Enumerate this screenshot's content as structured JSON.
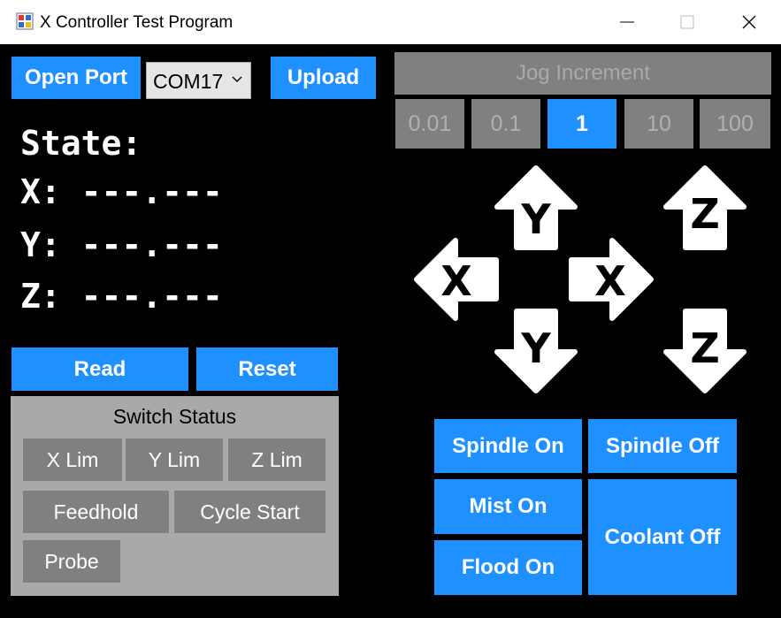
{
  "window": {
    "title": "X Controller Test Program"
  },
  "toolbar": {
    "open_port_label": "Open Port",
    "port_selected": "COM17",
    "upload_label": "Upload"
  },
  "state": {
    "state_label": "State:",
    "x_line": "X: ---.---",
    "y_line": "Y: ---.---",
    "z_line": "Z: ---.---"
  },
  "actions": {
    "read_label": "Read",
    "reset_label": "Reset"
  },
  "switch_status": {
    "title": "Switch Status",
    "x_lim": "X Lim",
    "y_lim": "Y Lim",
    "z_lim": "Z Lim",
    "feedhold": "Feedhold",
    "cycle_start": "Cycle Start",
    "probe": "Probe"
  },
  "jog": {
    "header": "Jog Increment",
    "increments": [
      "0.01",
      "0.1",
      "1",
      "10",
      "100"
    ],
    "selected": "1",
    "arrows": {
      "y_plus": "Y",
      "y_minus": "Y",
      "x_minus": "X",
      "x_plus": "X",
      "z_plus": "Z",
      "z_minus": "Z"
    }
  },
  "coolant": {
    "spindle_on": "Spindle On",
    "spindle_off": "Spindle Off",
    "mist_on": "Mist On",
    "flood_on": "Flood On",
    "coolant_off": "Coolant Off"
  },
  "colors": {
    "accent": "#1e90ff",
    "inactive": "#808080",
    "panel": "#a9a9a9",
    "background": "#000000"
  }
}
